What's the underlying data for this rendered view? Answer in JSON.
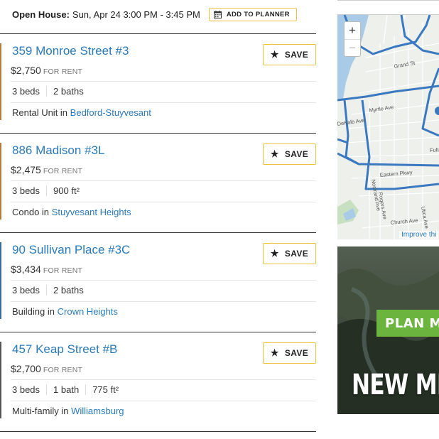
{
  "open_house": {
    "label": "Open House:",
    "text": "Sun, Apr 24  3:00 PM - 3:45 PM",
    "planner_button": "ADD TO PLANNER"
  },
  "listings": [
    {
      "title": "359 Monroe Street #3",
      "price": "$2,750",
      "price_suffix": "FOR RENT",
      "facts": [
        "3 beds",
        "2 baths"
      ],
      "type_prefix": "Rental Unit in",
      "neighborhood": "Bedford-Stuyvesant",
      "save_label": "SAVE"
    },
    {
      "title": "886 Madison #3L",
      "price": "$2,475",
      "price_suffix": "FOR RENT",
      "facts": [
        "3 beds",
        "900 ft²"
      ],
      "type_prefix": "Condo in",
      "neighborhood": "Stuyvesant Heights",
      "save_label": "SAVE"
    },
    {
      "title": "90 Sullivan Place #3C",
      "price": "$3,434",
      "price_suffix": "FOR RENT",
      "facts": [
        "3 beds",
        "2 baths"
      ],
      "type_prefix": "Building in",
      "neighborhood": "Crown Heights",
      "save_label": "SAVE"
    },
    {
      "title": "457 Keap Street #B",
      "price": "$2,700",
      "price_suffix": "FOR RENT",
      "facts": [
        "3 beds",
        "1 bath",
        "775 ft²"
      ],
      "type_prefix": "Multi-family in",
      "neighborhood": "Williamsburg",
      "save_label": "SAVE"
    }
  ],
  "map": {
    "zoom_in": "+",
    "zoom_out": "−",
    "labels": [
      "Grand St",
      "Myrtle Ave",
      "DeKalb Ave",
      "Eastern Pkwy",
      "Nostrand Ave",
      "Rogers Ave",
      "Utica Ave",
      "Church Ave",
      "Fulton"
    ],
    "improve_link": "Improve thi"
  },
  "ad": {
    "button_text": "PLAN MY A",
    "headline": "NEW MEX"
  },
  "colors": {
    "link": "#2a7ab8",
    "button_border": "#f0c040",
    "route": "#3a78c0",
    "ad_green": "#6bb43e"
  }
}
